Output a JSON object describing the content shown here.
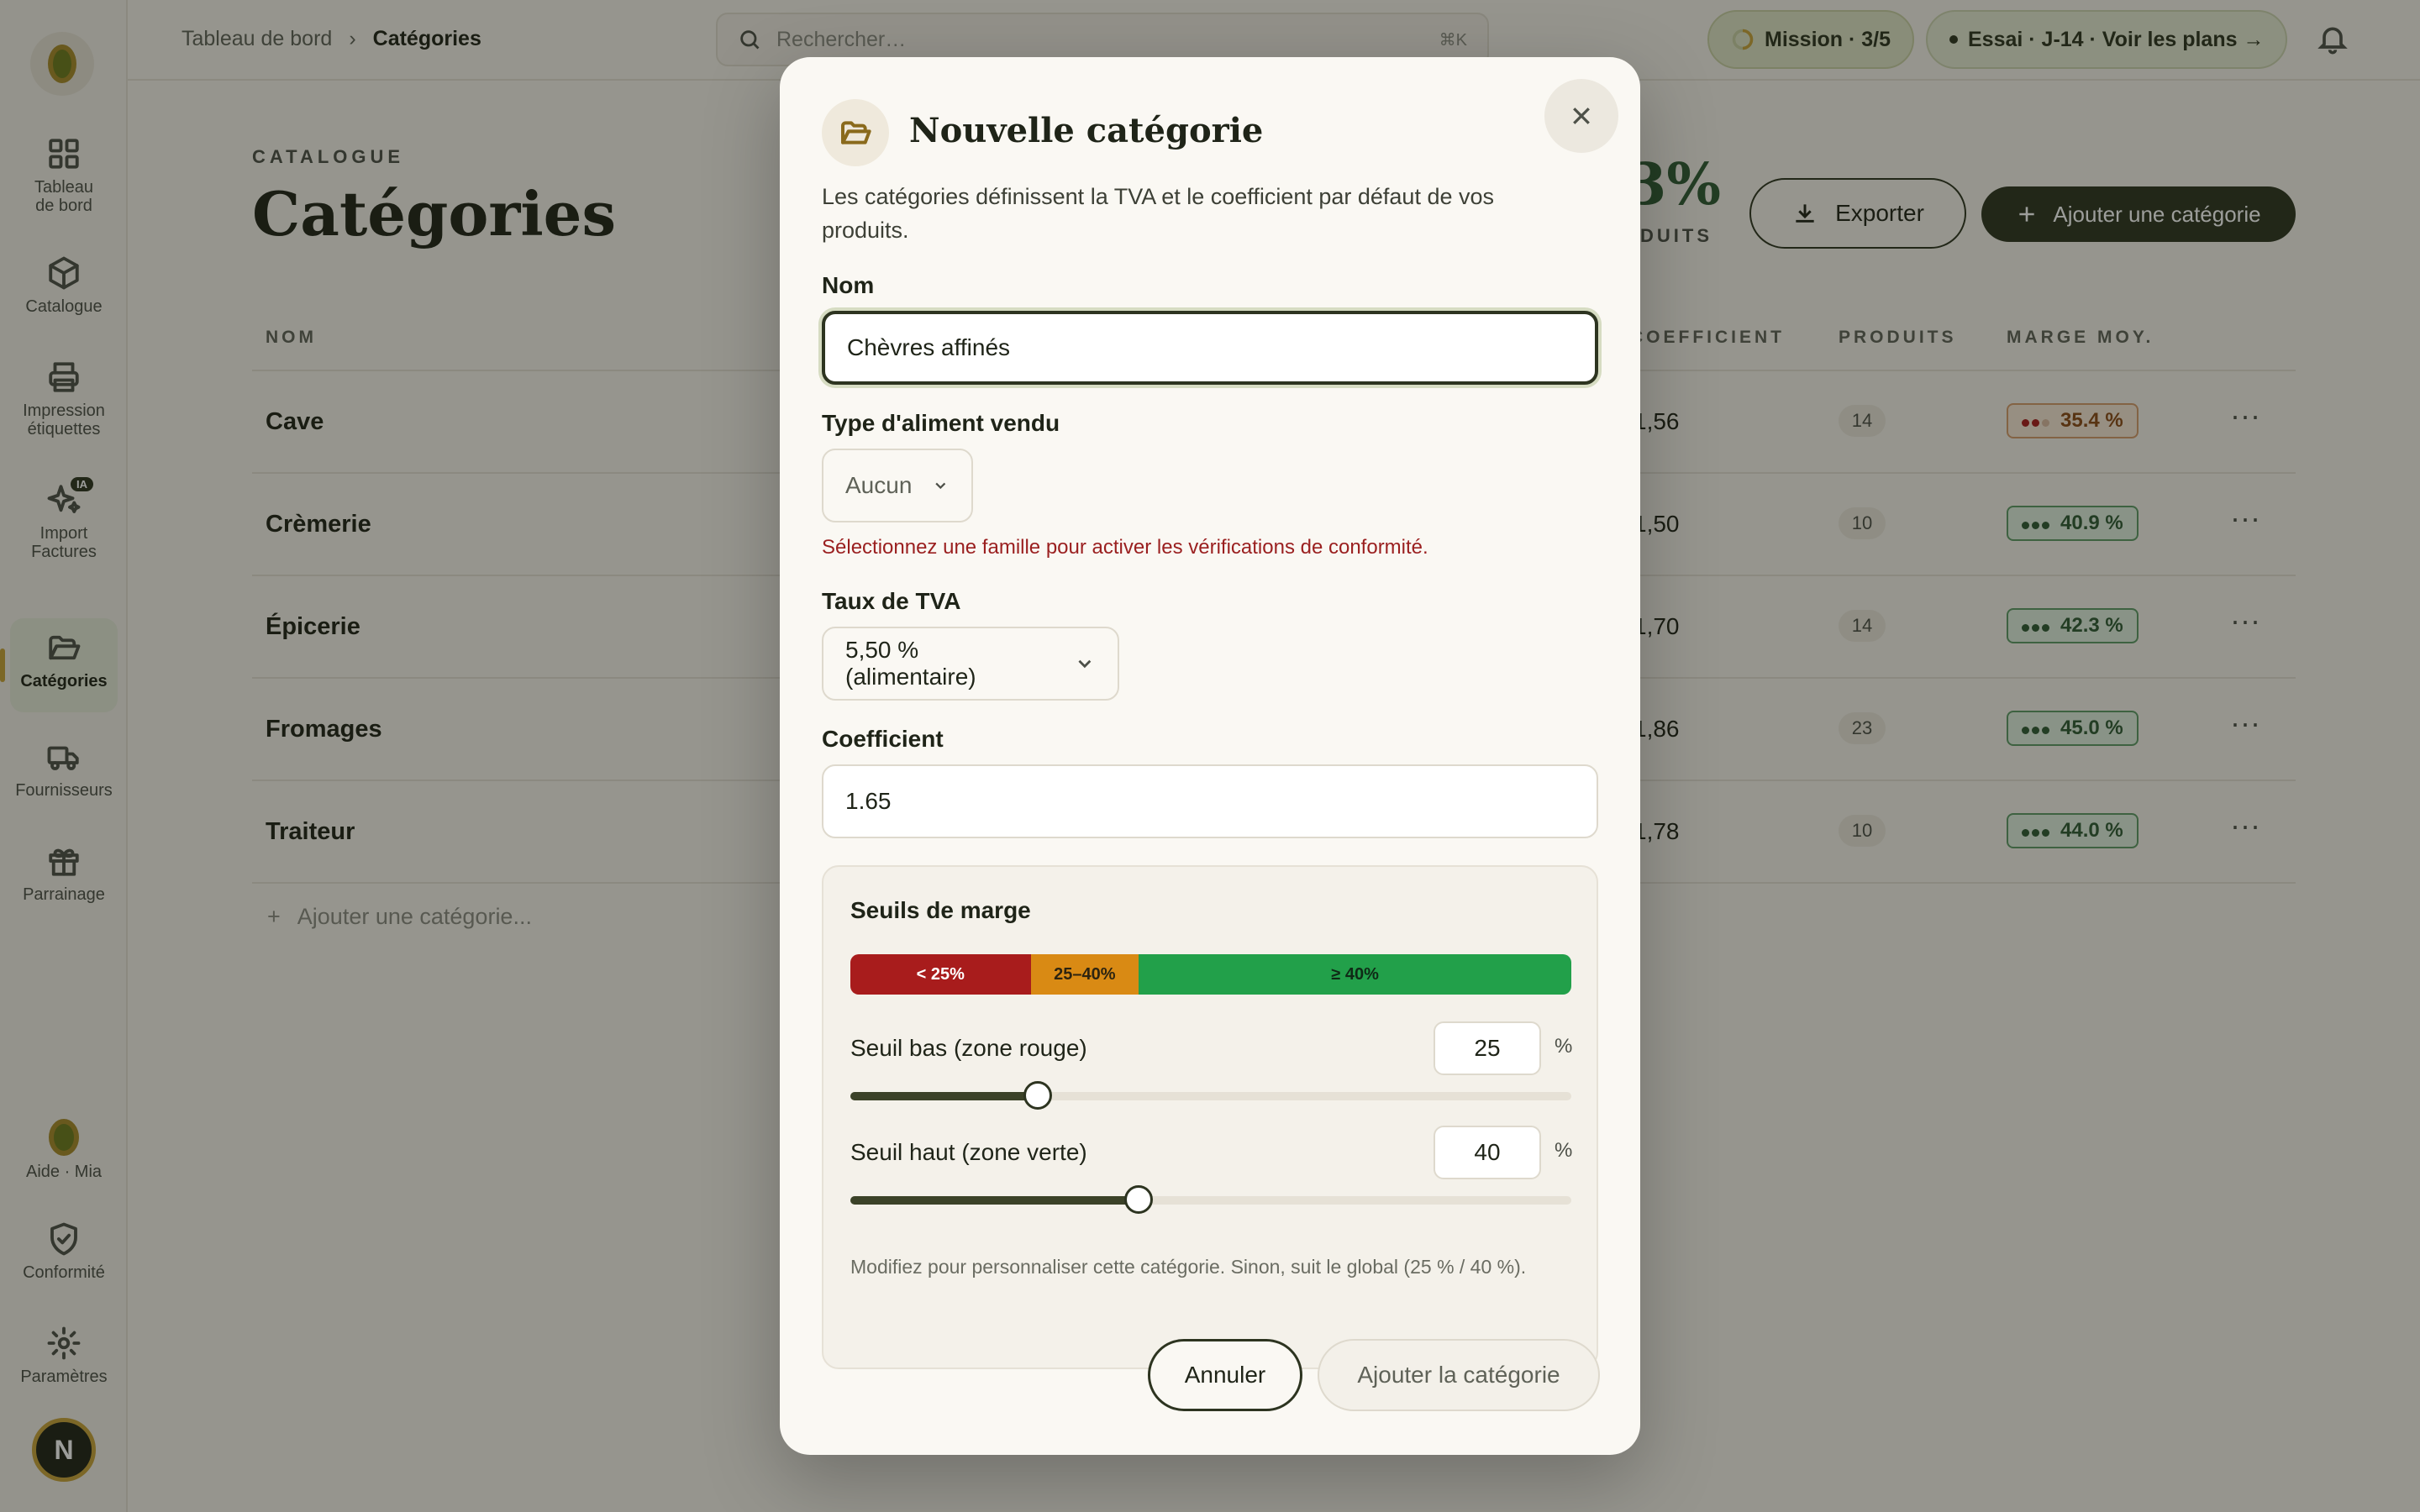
{
  "sidebar": {
    "items": [
      {
        "label": "Tableau de bord"
      },
      {
        "label": "Catalogue"
      },
      {
        "label": "Impression étiquettes"
      },
      {
        "label": "Import Factures",
        "badge": "IA"
      },
      {
        "label": "Catégories"
      },
      {
        "label": "Fournisseurs"
      },
      {
        "label": "Parrainage"
      }
    ],
    "bottom": {
      "help": "Aide · Mia",
      "compliance": "Conformité",
      "settings": "Paramètres",
      "avatar_initial": "N"
    }
  },
  "topbar": {
    "breadcrumb": [
      "Tableau de bord",
      "Catégories"
    ],
    "search_placeholder": "Rechercher…",
    "search_shortcut": "⌘K",
    "mission": "Mission · 3/5",
    "trial": "Essai · J-14 · Voir les plans →"
  },
  "page": {
    "eyebrow": "CATALOGUE",
    "title": "Catégories",
    "stat_value": "3%",
    "stat_label": "DUITS",
    "export_label": "Exporter",
    "add_label": "Ajouter une catégorie",
    "columns": {
      "name": "NOM",
      "coef": "COEFFICIENT",
      "products": "PRODUITS",
      "margin": "MARGE MOY."
    },
    "rows": [
      {
        "name": "Cave",
        "coef": "1,56",
        "products": "14",
        "margin": "35.4 %",
        "status": "mid"
      },
      {
        "name": "Crèmerie",
        "coef": "1,50",
        "products": "10",
        "margin": "40.9 %",
        "status": "good"
      },
      {
        "name": "Épicerie",
        "coef": "1,70",
        "products": "14",
        "margin": "42.3 %",
        "status": "good"
      },
      {
        "name": "Fromages",
        "coef": "1,86",
        "products": "23",
        "margin": "45.0 %",
        "status": "good"
      },
      {
        "name": "Traiteur",
        "coef": "1,78",
        "products": "10",
        "margin": "44.0 %",
        "status": "good"
      }
    ],
    "add_row": "Ajouter une catégorie..."
  },
  "modal": {
    "title": "Nouvelle catégorie",
    "description": "Les catégories définissent la TVA et le coefficient par défaut de vos produits.",
    "name_label": "Nom",
    "name_value": "Chèvres affinés",
    "food_type_label": "Type d'aliment vendu",
    "food_type_value": "Aucun",
    "food_type_error": "Sélectionnez une famille pour activer les vérifications de conformité.",
    "vat_label": "Taux de TVA",
    "vat_value": "5,50 % (alimentaire)",
    "coef_label": "Coefficient",
    "coef_value": "1.65",
    "thresholds": {
      "title": "Seuils de marge",
      "zones": [
        "< 25%",
        "25–40%",
        "≥ 40%"
      ],
      "low_label": "Seuil bas (zone rouge)",
      "low_value": "25",
      "high_label": "Seuil haut (zone verte)",
      "high_value": "40",
      "unit": "%",
      "hint": "Modifiez pour personnaliser cette catégorie. Sinon, suit le global (25 % / 40 %)."
    },
    "cancel_label": "Annuler",
    "submit_label": "Ajouter la catégorie"
  },
  "colors": {
    "accent": "#2d3420",
    "gold": "#c8a23a",
    "red": "#a81c1c",
    "orange": "#d98a14",
    "green": "#22a04a"
  }
}
